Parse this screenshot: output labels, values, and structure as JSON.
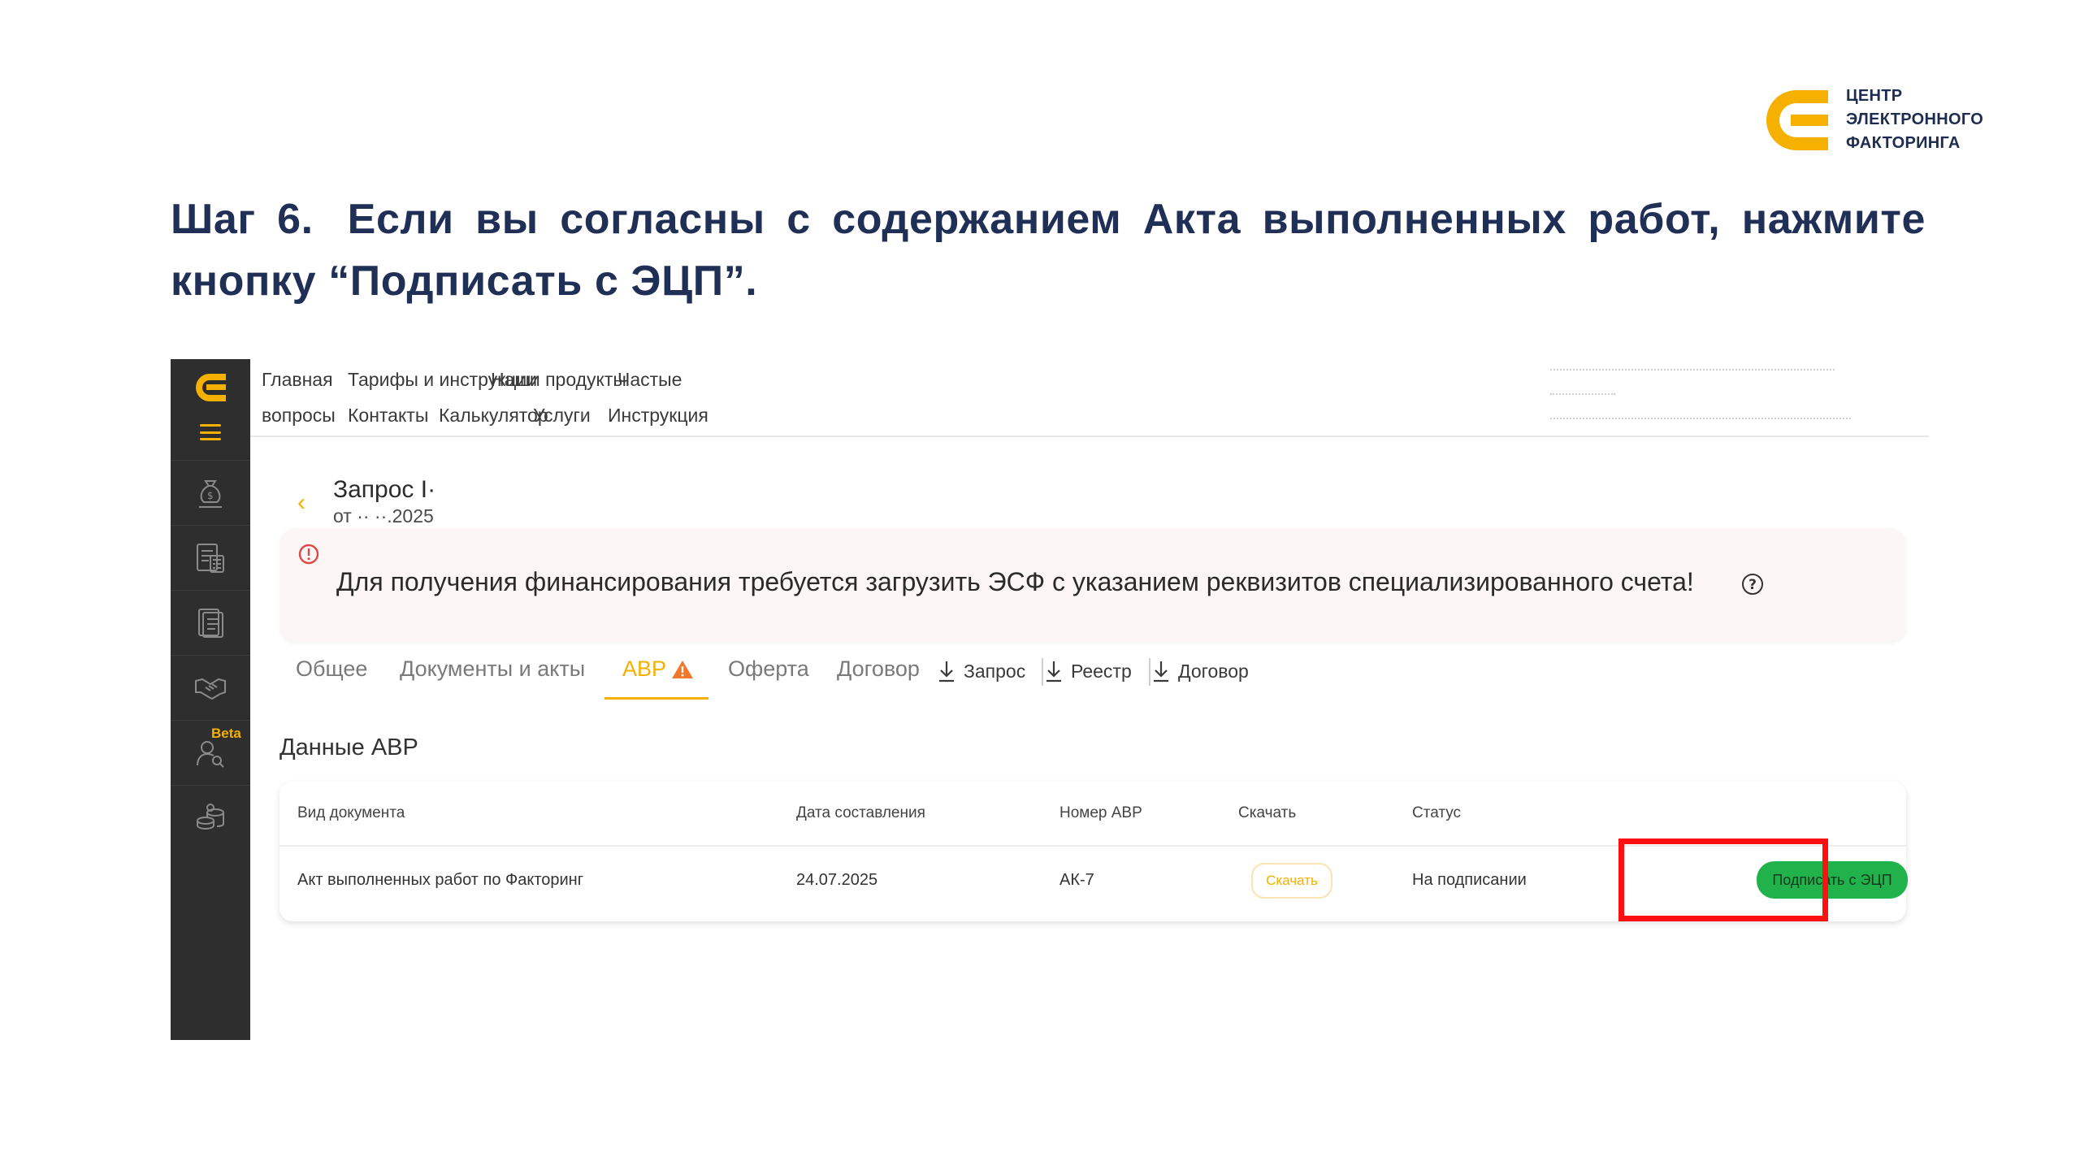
{
  "brand": {
    "lines": [
      "ЦЕНТР",
      "ЭЛЕКТРОННОГО",
      "ФАКТОРИНГА"
    ],
    "accent_color": "#f5b000"
  },
  "instruction": {
    "step": "Шаг 6.",
    "text": "Если вы согласны с содержанием Акта выполненных работ, нажмите кнопку “Подписать с ЭЦП”."
  },
  "app": {
    "sidebar": {
      "icons": [
        "logo-icon",
        "menu-icon",
        "money-bag-icon",
        "calculator-doc-icon",
        "documents-icon",
        "handshake-icon",
        "user-search-icon",
        "coins-icon"
      ],
      "beta_label": "Beta"
    },
    "nav": {
      "home": "Главная",
      "tariffs": "Тарифы и инструкции",
      "products": "Наши продукты",
      "faq_line1": "Частые",
      "faq_line2": "вопросы",
      "contacts": "Контакты",
      "calculator": "Калькулятор",
      "services": "Услуги",
      "instruction": "Инструкция"
    },
    "request": {
      "title": "Запрос I·",
      "date": "от ·· ··.2025"
    },
    "alert": {
      "text": "Для получения финансирования требуется загрузить ЭСФ с указанием реквизитов специализированного счета!"
    },
    "tabs": {
      "general": "Общее",
      "documents": "Документы и акты",
      "avr": "АВР",
      "offer": "Оферта",
      "contract": "Договор"
    },
    "downloads": {
      "request": "Запрос",
      "registry": "Реестр",
      "contract": "Договор"
    },
    "section_title": "Данные АВР",
    "table": {
      "headers": [
        "Вид документа",
        "Дата составления",
        "Номер АВР",
        "Скачать",
        "Статус"
      ],
      "row": {
        "doc_type": "Акт выполненных работ по Факторинг",
        "date": "24.07.2025",
        "number": "АК-7",
        "download": "Скачать",
        "status": "На подписании",
        "action": "Подписать с ЭЦП"
      }
    }
  }
}
